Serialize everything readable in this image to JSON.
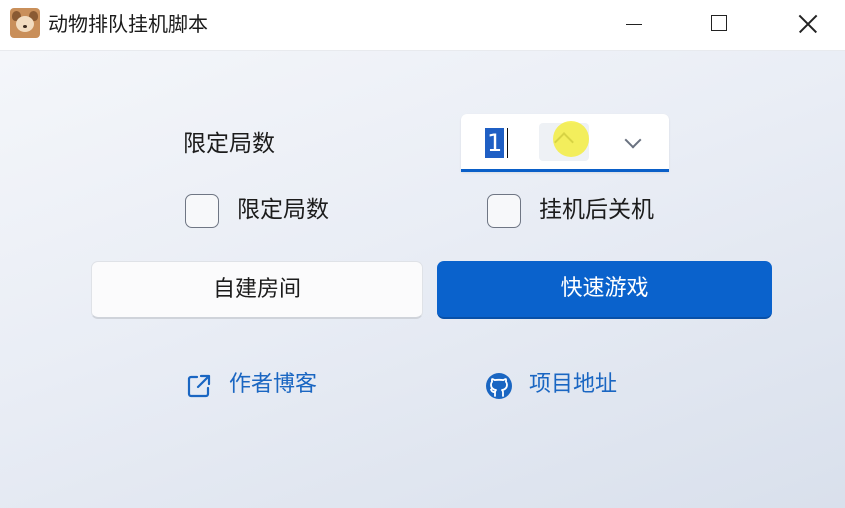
{
  "window": {
    "title": "动物排队挂机脚本",
    "icon": "dog-app-icon"
  },
  "settings": {
    "rounds_label": "限定局数",
    "rounds_value": "1",
    "limit_checkbox_label": "限定局数",
    "limit_checked": false,
    "shutdown_checkbox_label": "挂机后关机",
    "shutdown_checked": false
  },
  "actions": {
    "create_room_label": "自建房间",
    "quick_game_label": "快速游戏"
  },
  "links": {
    "blog_label": "作者博客",
    "repo_label": "项目地址"
  },
  "colors": {
    "accent": "#0a62cc",
    "link": "#1a66c2",
    "cursor_highlight": "#f4ec28"
  }
}
